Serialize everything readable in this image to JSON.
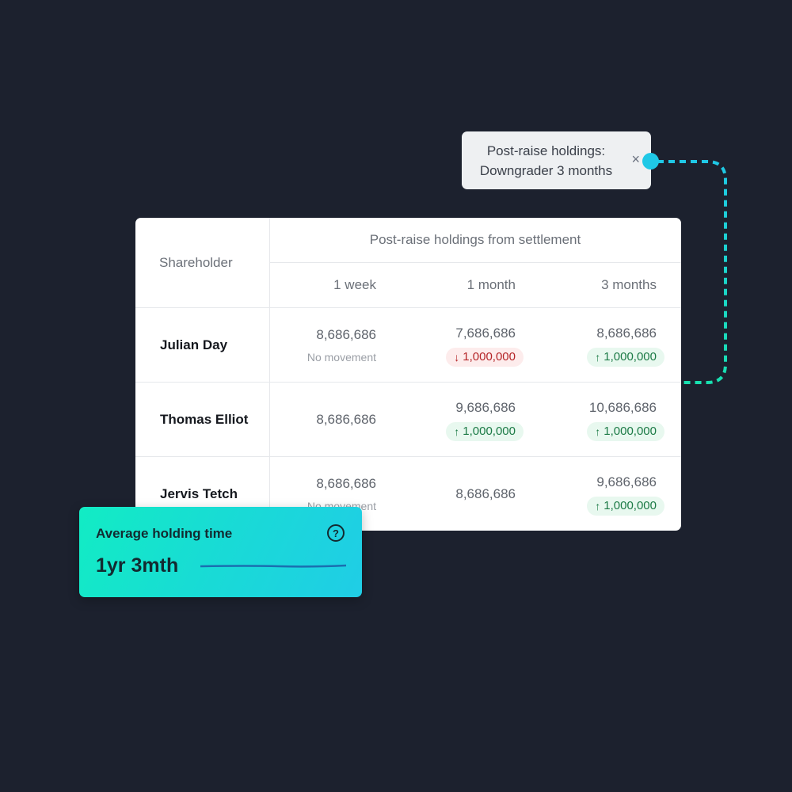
{
  "tooltip": {
    "line1": "Post-raise holdings:",
    "line2": "Downgrader 3 months",
    "close_icon": "×"
  },
  "colors": {
    "background": "#1c212e",
    "connector_start": "#1fc8e6",
    "connector_end": "#18e0b0",
    "down": "#b42326",
    "up": "#1b7a45"
  },
  "table": {
    "shareholder_header": "Shareholder",
    "group_header": "Post-raise holdings from settlement",
    "columns": [
      "1 week",
      "1 month",
      "3 months"
    ],
    "rows": [
      {
        "name": "Julian Day",
        "cells": [
          {
            "value": "8,686,686",
            "sub": "No movement",
            "type": "none"
          },
          {
            "value": "7,686,686",
            "sub": "1,000,000",
            "type": "down",
            "arrow": "↓"
          },
          {
            "value": "8,686,686",
            "sub": "1,000,000",
            "type": "up",
            "arrow": "↑"
          }
        ]
      },
      {
        "name": "Thomas Elliot",
        "cells": [
          {
            "value": "8,686,686",
            "sub": null,
            "type": "plain"
          },
          {
            "value": "9,686,686",
            "sub": "1,000,000",
            "type": "up",
            "arrow": "↑"
          },
          {
            "value": "10,686,686",
            "sub": "1,000,000",
            "type": "up",
            "arrow": "↑"
          }
        ]
      },
      {
        "name": "Jervis Tetch",
        "cells": [
          {
            "value": "8,686,686",
            "sub": "No movement",
            "type": "none"
          },
          {
            "value": "8,686,686",
            "sub": null,
            "type": "plain"
          },
          {
            "value": "9,686,686",
            "sub": "1,000,000",
            "type": "up",
            "arrow": "↑"
          }
        ]
      }
    ]
  },
  "avg_card": {
    "title": "Average holding time",
    "value": "1yr 3mth",
    "help_icon": "?"
  }
}
